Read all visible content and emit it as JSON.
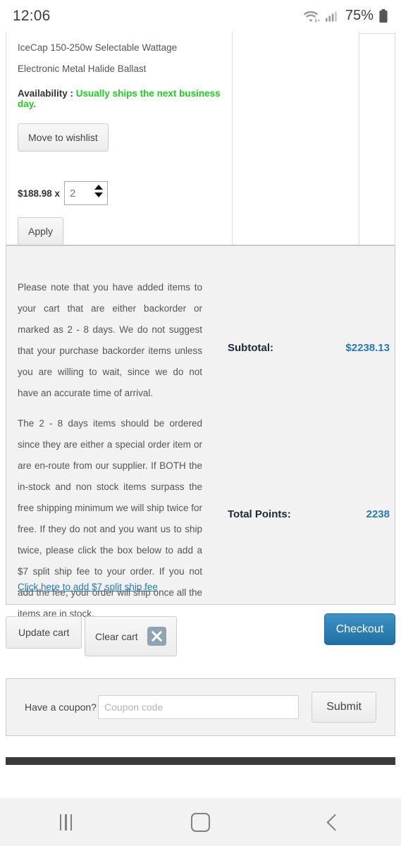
{
  "status_bar": {
    "time": "12:06",
    "battery_percent": "75%",
    "icons": [
      "wifi-icon",
      "signal-icon",
      "battery-icon"
    ]
  },
  "cart": {
    "product_title": "IceCap 150-250w Selectable Wattage Electronic Metal Halide Ballast",
    "availability_label": "Availability :",
    "availability_value": "Usually ships the next business day.",
    "wishlist_button": "Move to wishlist",
    "price": "$188.98 x",
    "quantity": "2",
    "apply_button": "Apply"
  },
  "summary": {
    "notice_paragraph_1": "Please note that you have added items to your cart that are either backorder or marked as 2 - 8 days. We do not suggest that your purchase backorder items unless you are willing to wait, since we do not have an accurate time of arrival.",
    "notice_paragraph_2": "The 2 - 8 days items should be ordered since they are either a special order item or are en-route from our supplier. If BOTH the in-stock and non stock items surpass the free shipping minimum we will ship twice for free. If they do not and you want us to ship twice, please click the box below to add a $7 split ship fee to your order. If you not add the fee, your order will ship once all the items are in stock.",
    "split_ship_link": "Click here to add $7 split ship fee",
    "subtotal_label": "Subtotal:",
    "subtotal_value": "$2238.13",
    "points_label": "Total Points:",
    "points_value": "2238"
  },
  "actions": {
    "update_cart": "Update cart",
    "clear_cart": "Clear cart",
    "checkout": "Checkout"
  },
  "coupon": {
    "label": "Have a coupon?",
    "placeholder": "Coupon code",
    "submit": "Submit"
  },
  "colors": {
    "accent_blue": "#2a7ab0",
    "availability_green": "#22cc22",
    "checkout_blue": "#1f6fa5",
    "panel_grey": "#f2f2f2"
  },
  "nav_bar": {
    "recents": "recents-icon",
    "home": "home-icon",
    "back": "back-icon"
  }
}
